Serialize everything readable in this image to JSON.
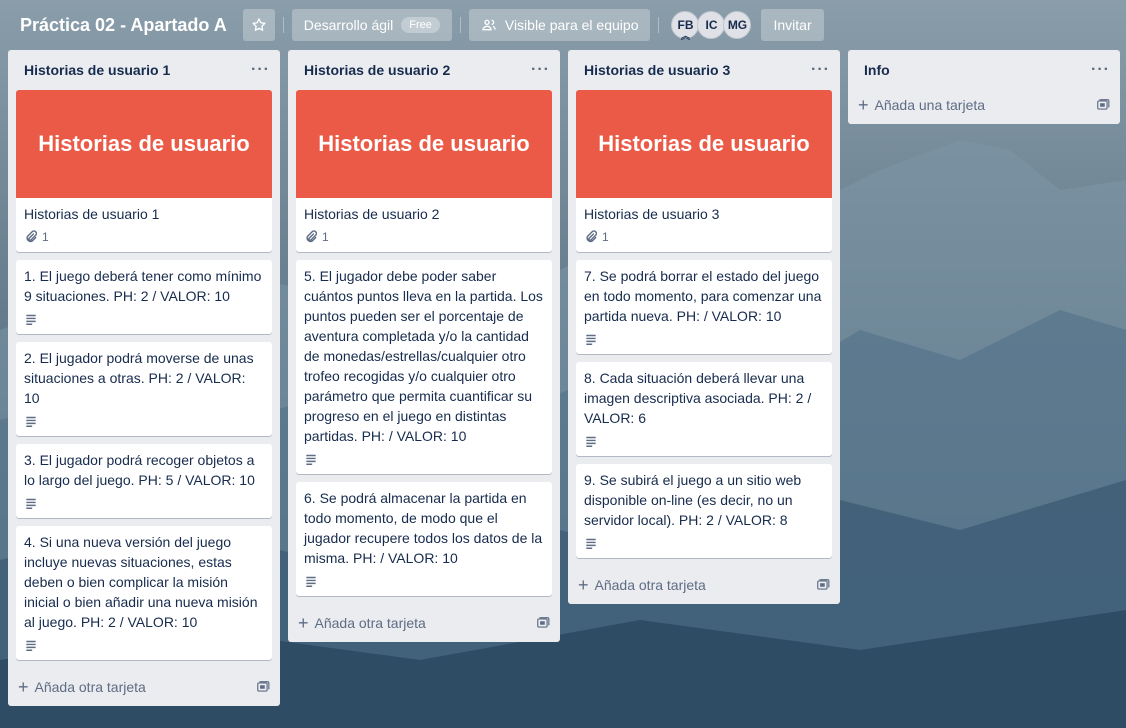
{
  "board": {
    "title": "Práctica 02 - Apartado A",
    "workspace": "Desarrollo ágil",
    "workspace_badge": "Free",
    "visibility": "Visible para el equipo",
    "members": [
      "FB",
      "IC",
      "MG"
    ],
    "invite_label": "Invitar"
  },
  "lists": [
    {
      "title": "Historias de usuario 1",
      "add_label": "Añada otra tarjeta",
      "cards": [
        {
          "cover": "Historias de usuario",
          "title": "Historias de usuario 1",
          "attachments": "1"
        },
        {
          "title": "1. El juego deberá tener como mínimo 9 situaciones. PH: 2 / VALOR: 10"
        },
        {
          "title": "2. El jugador podrá moverse de unas situaciones a otras. PH: 2 / VALOR: 10"
        },
        {
          "title": "3. El jugador podrá recoger objetos a lo largo del juego. PH: 5 / VALOR: 10"
        },
        {
          "title": "4. Si una nueva versión del juego incluye nuevas situaciones, estas deben o bien complicar la misión inicial o bien añadir una nueva misión al juego. PH: 2 / VALOR: 10"
        }
      ]
    },
    {
      "title": "Historias de usuario 2",
      "add_label": "Añada otra tarjeta",
      "cards": [
        {
          "cover": "Historias de usuario",
          "title": "Historias de usuario 2",
          "attachments": "1"
        },
        {
          "title": "5. El jugador debe poder saber cuántos puntos lleva en la partida. Los puntos pueden ser el porcentaje de aventura completada y/o la cantidad de monedas/estrellas/cualquier otro trofeo recogidas y/o cualquier otro parámetro que permita cuantificar su progreso en el juego en distintas partidas. PH: / VALOR: 10"
        },
        {
          "title": "6. Se podrá almacenar la partida en todo momento, de modo que el jugador recupere todos los datos de la misma. PH: / VALOR: 10"
        }
      ]
    },
    {
      "title": "Historias de usuario 3",
      "add_label": "Añada otra tarjeta",
      "cards": [
        {
          "cover": "Historias de usuario",
          "title": "Historias de usuario 3",
          "attachments": "1"
        },
        {
          "title": "7. Se podrá borrar el estado del juego en todo momento, para comenzar una partida nueva. PH: / VALOR: 10"
        },
        {
          "title": "8. Cada situación deberá llevar una imagen descriptiva asociada. PH: 2 / VALOR: 6"
        },
        {
          "title": "9. Se subirá el juego a un sitio web disponible on-line (es decir, no un servidor local). PH: 2 / VALOR: 8"
        }
      ]
    },
    {
      "title": "Info",
      "add_label": "Añada una tarjeta",
      "cards": []
    }
  ],
  "colors": {
    "cover": "#eb5a46",
    "list_bg": "#ebecf0"
  },
  "icons": {
    "star": "star-icon",
    "visibility": "team-visibility-icon",
    "menu": "ellipsis-icon",
    "attachment": "paperclip-icon",
    "description": "description-icon",
    "template": "card-template-icon",
    "add": "plus-icon"
  }
}
